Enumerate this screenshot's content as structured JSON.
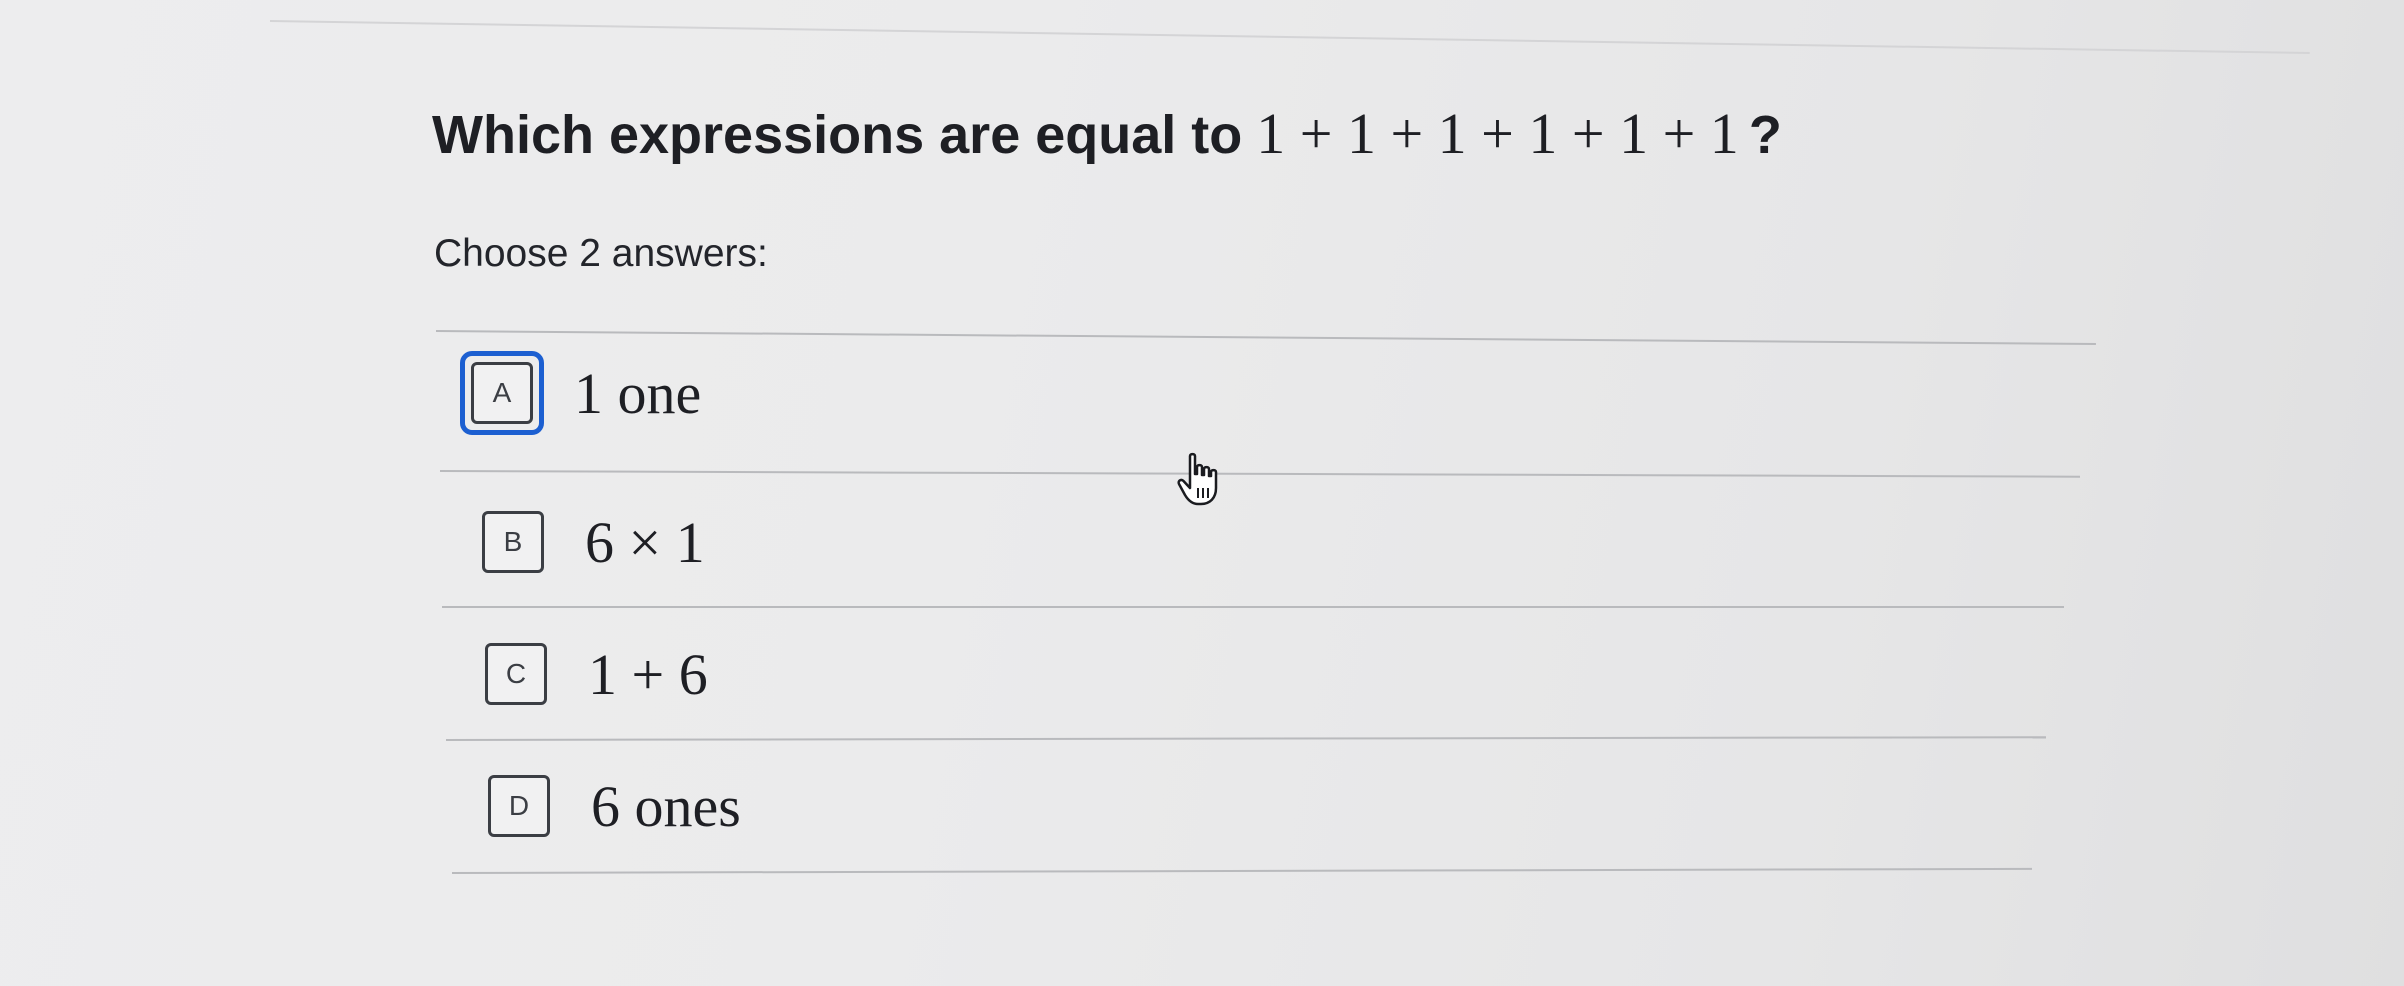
{
  "question": {
    "prefix": "Which expressions are equal to",
    "expression": "1 + 1 + 1 + 1 + 1 + 1",
    "suffix": "?"
  },
  "instruction": "Choose 2 answers:",
  "choices": [
    {
      "letter": "A",
      "text": "1 one",
      "focused": true
    },
    {
      "letter": "B",
      "text": "6 × 1",
      "focused": false
    },
    {
      "letter": "C",
      "text": "1 + 6",
      "focused": false
    },
    {
      "letter": "D",
      "text": "6 ones",
      "focused": false
    }
  ],
  "colors": {
    "focus_ring": "#1c5fd1",
    "text": "#1e1f24",
    "background": "#ebebec"
  },
  "icons": {
    "pointer": "hand-pointer-icon"
  }
}
